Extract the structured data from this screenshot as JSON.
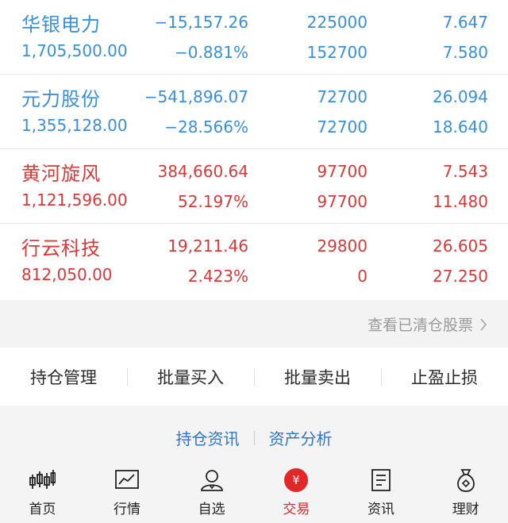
{
  "holdings": [
    {
      "name": "华银电力",
      "value": "1,705,500.00",
      "pnl": "−15,157.26",
      "pnl_pct": "−0.881%",
      "qty": "225000",
      "avail": "152700",
      "cost": "7.647",
      "price": "7.580",
      "trend": "down"
    },
    {
      "name": "元力股份",
      "value": "1,355,128.00",
      "pnl": "−541,896.07",
      "pnl_pct": "−28.566%",
      "qty": "72700",
      "avail": "72700",
      "cost": "26.094",
      "price": "18.640",
      "trend": "down"
    },
    {
      "name": "黄河旋风",
      "value": "1,121,596.00",
      "pnl": "384,660.64",
      "pnl_pct": "52.197%",
      "qty": "97700",
      "avail": "97700",
      "cost": "7.543",
      "price": "11.480",
      "trend": "up"
    },
    {
      "name": "行云科技",
      "value": "812,050.00",
      "pnl": "19,211.46",
      "pnl_pct": "2.423%",
      "qty": "29800",
      "avail": "0",
      "cost": "26.605",
      "price": "27.250",
      "trend": "up"
    }
  ],
  "cleared_link": "查看已清仓股票",
  "actions": {
    "position_mgmt": "持仓管理",
    "batch_buy": "批量买入",
    "batch_sell": "批量卖出",
    "stop_profit_loss": "止盈止损"
  },
  "sublinks": {
    "holding_news": "持仓资讯",
    "asset_analysis": "资产分析"
  },
  "tabbar": {
    "home": "首页",
    "market": "行情",
    "watchlist": "自选",
    "trade": "交易",
    "news": "资讯",
    "wealth": "理财",
    "active": "trade"
  },
  "colors": {
    "down": "#3b8fd6",
    "up": "#d63a3a",
    "active_tab": "#e02828",
    "link": "#2f74c8"
  }
}
